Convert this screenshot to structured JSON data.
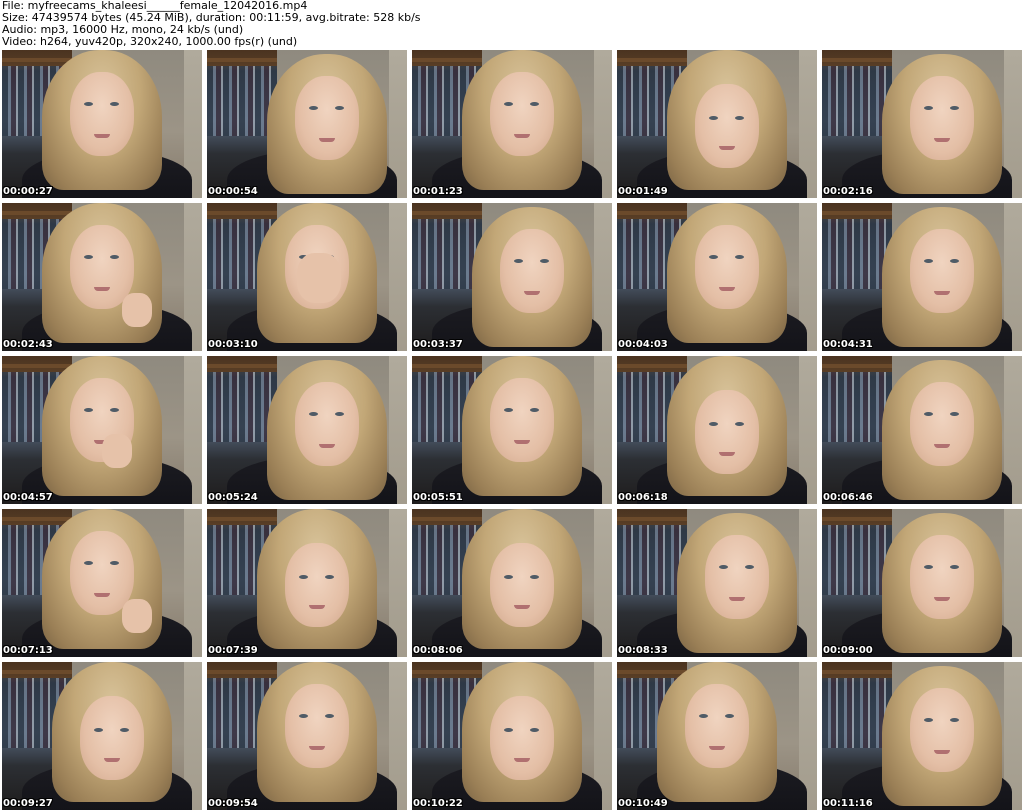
{
  "info": {
    "file": "File: myfreecams_khaleesi______female_12042016.mp4",
    "size": "Size: 47439574 bytes (45.24 MiB), duration: 00:11:59, avg.bitrate: 528 kb/s",
    "audio": "Audio: mp3, 16000 Hz, mono, 24 kb/s (und)",
    "video": "Video: h264, yuv420p, 320x240, 1000.00 fps(r) (und)"
  },
  "thumbnails": [
    {
      "time": "00:00:27"
    },
    {
      "time": "00:00:54"
    },
    {
      "time": "00:01:23"
    },
    {
      "time": "00:01:49"
    },
    {
      "time": "00:02:16"
    },
    {
      "time": "00:02:43"
    },
    {
      "time": "00:03:10"
    },
    {
      "time": "00:03:37"
    },
    {
      "time": "00:04:03"
    },
    {
      "time": "00:04:31"
    },
    {
      "time": "00:04:57"
    },
    {
      "time": "00:05:24"
    },
    {
      "time": "00:05:51"
    },
    {
      "time": "00:06:18"
    },
    {
      "time": "00:06:46"
    },
    {
      "time": "00:07:13"
    },
    {
      "time": "00:07:39"
    },
    {
      "time": "00:08:06"
    },
    {
      "time": "00:08:33"
    },
    {
      "time": "00:09:00"
    },
    {
      "time": "00:09:27"
    },
    {
      "time": "00:09:54"
    },
    {
      "time": "00:10:22"
    },
    {
      "time": "00:10:49"
    },
    {
      "time": "00:11:16"
    }
  ]
}
